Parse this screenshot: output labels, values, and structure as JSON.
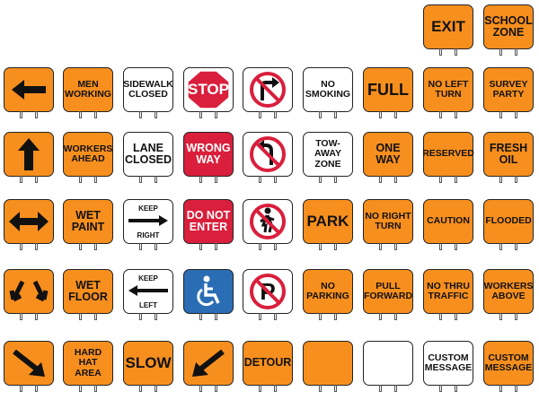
{
  "palette": {
    "orange": "#f78f1e",
    "white": "#ffffff",
    "red": "#d91f3c",
    "blue": "#2a6db5",
    "outline": "#222222"
  },
  "signs": {
    "exit": "EXIT",
    "school_zone": "SCHOOL\nZONE",
    "men_working": "MEN\nWORKING",
    "sidewalk_closed": "SIDEWALK\nCLOSED",
    "stop": "STOP",
    "no_smoking": "NO\nSMOKING",
    "full": "FULL",
    "no_left_turn": "NO LEFT\nTURN",
    "survey_party": "SURVEY\nPARTY",
    "workers_ahead": "WORKERS\nAHEAD",
    "lane_closed": "LANE\nCLOSED",
    "wrong_way": "WRONG\nWAY",
    "tow_away_zone": "TOW-AWAY\nZONE",
    "one_way": "ONE WAY",
    "reserved": "RESERVED",
    "fresh_oil": "FRESH\nOIL",
    "wet_paint": "WET\nPAINT",
    "keep_right_top": "KEEP",
    "keep_right_bottom": "RIGHT",
    "do_not_enter": "DO NOT\nENTER",
    "park": "PARK",
    "no_right_turn": "NO RIGHT\nTURN",
    "caution": "CAUTION",
    "flooded": "FLOODED",
    "wet_floor": "WET\nFLOOR",
    "keep_left_top": "KEEP",
    "keep_left_bottom": "LEFT",
    "no_parking": "NO\nPARKING",
    "pull_forward": "PULL\nFORWARD",
    "no_thru_traffic": "NO THRU\nTRAFFIC",
    "workers_above": "WORKERS\nABOVE",
    "hard_hat_area": "HARD HAT\nAREA",
    "slow": "SLOW",
    "detour": "DETOUR",
    "custom_message_white": "CUSTOM\nMESSAGE",
    "custom_message_orange": "CUSTOM\nMESSAGE"
  },
  "icons": {
    "left_arrow": "left-arrow-icon",
    "up_arrow": "up-arrow-icon",
    "double_arrow": "double-arrow-icon",
    "diagonal_arrows": "diagonal-down-arrows-icon",
    "down_right_arrow": "down-right-arrow-icon",
    "down_left_arrow": "down-left-arrow-icon",
    "no_right_turn": "no-right-turn-icon",
    "no_u_turn": "no-u-turn-icon",
    "no_pedestrian": "no-pedestrian-icon",
    "no_parking": "no-parking-icon",
    "handicap": "handicap-icon"
  }
}
